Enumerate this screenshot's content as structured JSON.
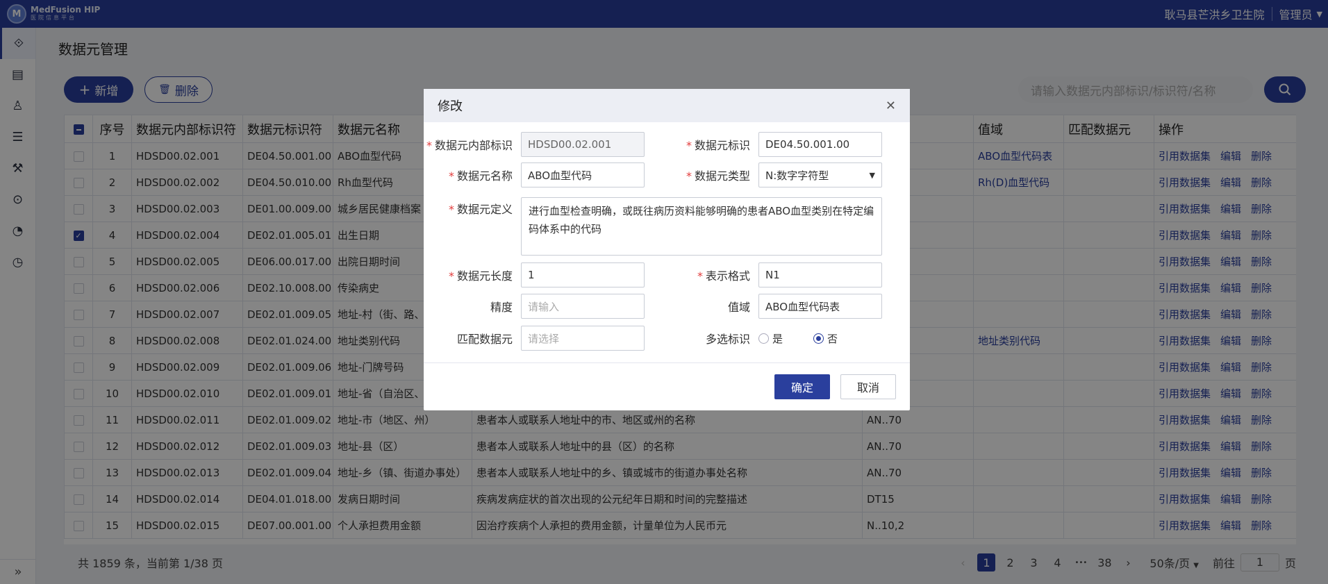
{
  "app": {
    "logo_mark": "M",
    "logo_en": "MedFusion HIP",
    "logo_cn": "医院信息平台",
    "org": "耿马县芒洪乡卫生院",
    "user": "管理员"
  },
  "page": {
    "title": "数据元管理",
    "add_label": "新增",
    "delete_label": "删除",
    "search_placeholder": "请输入数据元内部标识/标识符/名称"
  },
  "table": {
    "headers": {
      "index": "序号",
      "internal_id": "数据元内部标识符",
      "identifier": "数据元标识符",
      "name": "数据元名称",
      "definition": "",
      "format": "",
      "domain": "值域",
      "match": "匹配数据元",
      "ops": "操作"
    },
    "op_labels": {
      "ref": "引用数据集",
      "edit": "编辑",
      "del": "删除"
    },
    "rows": [
      {
        "idx": "1",
        "iid": "HDSD00.02.001",
        "code": "DE04.50.001.00",
        "name": "ABO血型代码",
        "def": "",
        "fmt": "",
        "domain": "ABO血型代码表",
        "checked": false
      },
      {
        "idx": "2",
        "iid": "HDSD00.02.002",
        "code": "DE04.50.010.00",
        "name": "Rh血型代码",
        "def": "",
        "fmt": "",
        "domain": "Rh(D)血型代码",
        "checked": false
      },
      {
        "idx": "3",
        "iid": "HDSD00.02.003",
        "code": "DE01.00.009.00",
        "name": "城乡居民健康档案",
        "def": "",
        "fmt": "",
        "domain": "",
        "checked": false
      },
      {
        "idx": "4",
        "iid": "HDSD00.02.004",
        "code": "DE02.01.005.01",
        "name": "出生日期",
        "def": "",
        "fmt": "",
        "domain": "",
        "checked": true
      },
      {
        "idx": "5",
        "iid": "HDSD00.02.005",
        "code": "DE06.00.017.00",
        "name": "出院日期时间",
        "def": "",
        "fmt": "",
        "domain": "",
        "checked": false
      },
      {
        "idx": "6",
        "iid": "HDSD00.02.006",
        "code": "DE02.10.008.00",
        "name": "传染病史",
        "def": "",
        "fmt": "",
        "domain": "",
        "checked": false
      },
      {
        "idx": "7",
        "iid": "HDSD00.02.007",
        "code": "DE02.01.009.05",
        "name": "地址-村（街、路、",
        "def": "",
        "fmt": "",
        "domain": "",
        "checked": false
      },
      {
        "idx": "8",
        "iid": "HDSD00.02.008",
        "code": "DE02.01.024.00",
        "name": "地址类别代码",
        "def": "",
        "fmt": "",
        "domain": "地址类别代码",
        "checked": false
      },
      {
        "idx": "9",
        "iid": "HDSD00.02.009",
        "code": "DE02.01.009.06",
        "name": "地址-门牌号码",
        "def": "",
        "fmt": "",
        "domain": "",
        "checked": false
      },
      {
        "idx": "10",
        "iid": "HDSD00.02.010",
        "code": "DE02.01.009.01",
        "name": "地址-省（自治区、市）",
        "def": "",
        "fmt": "",
        "domain": "",
        "checked": false
      },
      {
        "idx": "11",
        "iid": "HDSD00.02.011",
        "code": "DE02.01.009.02",
        "name": "地址-市（地区、州）",
        "def": "患者本人或联系人地址中的市、地区或州的名称",
        "fmt": "AN..70",
        "domain": "",
        "checked": false
      },
      {
        "idx": "12",
        "iid": "HDSD00.02.012",
        "code": "DE02.01.009.03",
        "name": "地址-县（区）",
        "def": "患者本人或联系人地址中的县（区）的名称",
        "fmt": "AN..70",
        "domain": "",
        "checked": false
      },
      {
        "idx": "13",
        "iid": "HDSD00.02.013",
        "code": "DE02.01.009.04",
        "name": "地址-乡（镇、街道办事处）",
        "def": "患者本人或联系人地址中的乡、镇或城市的街道办事处名称",
        "fmt": "AN..70",
        "domain": "",
        "checked": false
      },
      {
        "idx": "14",
        "iid": "HDSD00.02.014",
        "code": "DE04.01.018.00",
        "name": "发病日期时间",
        "def": "疾病发病症状的首次出现的公元纪年日期和时间的完整描述",
        "fmt": "DT15",
        "domain": "",
        "checked": false
      },
      {
        "idx": "15",
        "iid": "HDSD00.02.015",
        "code": "DE07.00.001.00",
        "name": "个人承担费用金额",
        "def": "因治疗疾病个人承担的费用金额，计量单位为人民币元",
        "fmt": "N..10,2",
        "domain": "",
        "checked": false
      }
    ]
  },
  "pager": {
    "total_text": "共 1859 条，当前第 1/38 页",
    "pages": [
      "1",
      "2",
      "3",
      "4"
    ],
    "ellipsis": "•••",
    "last": "38",
    "size": "50条/页",
    "goto_label": "前往",
    "goto_value": "1",
    "page_unit": "页"
  },
  "dialog": {
    "title": "修改",
    "labels": {
      "internal_id": "数据元内部标识",
      "identifier": "数据元标识",
      "name": "数据元名称",
      "type": "数据元类型",
      "definition": "数据元定义",
      "length": "数据元长度",
      "format": "表示格式",
      "precision": "精度",
      "domain": "值域",
      "match": "匹配数据元",
      "multi": "多选标识"
    },
    "values": {
      "internal_id": "HDSD00.02.001",
      "identifier": "DE04.50.001.00",
      "name": "ABO血型代码",
      "type": "N:数字字符型",
      "definition": "进行血型检查明确，或既往病历资料能够明确的患者ABO血型类别在特定编码体系中的代码",
      "length": "1",
      "format": "N1",
      "domain": "ABO血型代码表"
    },
    "placeholders": {
      "precision": "请输入",
      "match": "请选择"
    },
    "multi_options": {
      "yes": "是",
      "no": "否",
      "selected": "否"
    },
    "ok": "确定",
    "cancel": "取消"
  }
}
